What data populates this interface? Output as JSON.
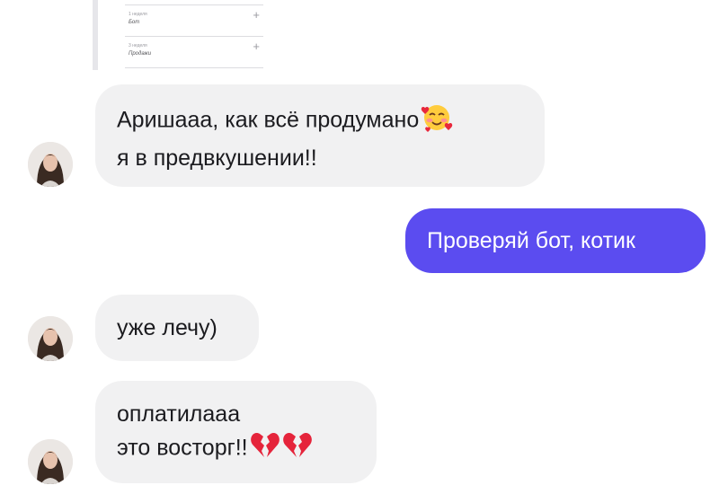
{
  "shared_card": {
    "rows": [
      {
        "caption": "1 неделя",
        "value": "Бот"
      },
      {
        "caption": "3 неделя",
        "value": "Продажи"
      }
    ],
    "expand_symbol": "+"
  },
  "messages": [
    {
      "direction": "incoming",
      "lines": [
        "Аришааа, как всё продумано",
        "я в предвкушении!!"
      ],
      "emoji": [
        "smiling-face-with-hearts"
      ]
    },
    {
      "direction": "outgoing",
      "lines": [
        "Проверяй бот, котик"
      ]
    },
    {
      "direction": "incoming",
      "lines": [
        "уже лечу)"
      ]
    },
    {
      "direction": "incoming",
      "lines": [
        "оплатилааа",
        "это восторг!!"
      ],
      "emoji": [
        "broken-heart",
        "broken-heart"
      ]
    }
  ],
  "colors": {
    "outgoing_bubble": "#5b4cf0",
    "incoming_bubble": "#f1f1f2",
    "text_dark": "#1b1b1f"
  }
}
